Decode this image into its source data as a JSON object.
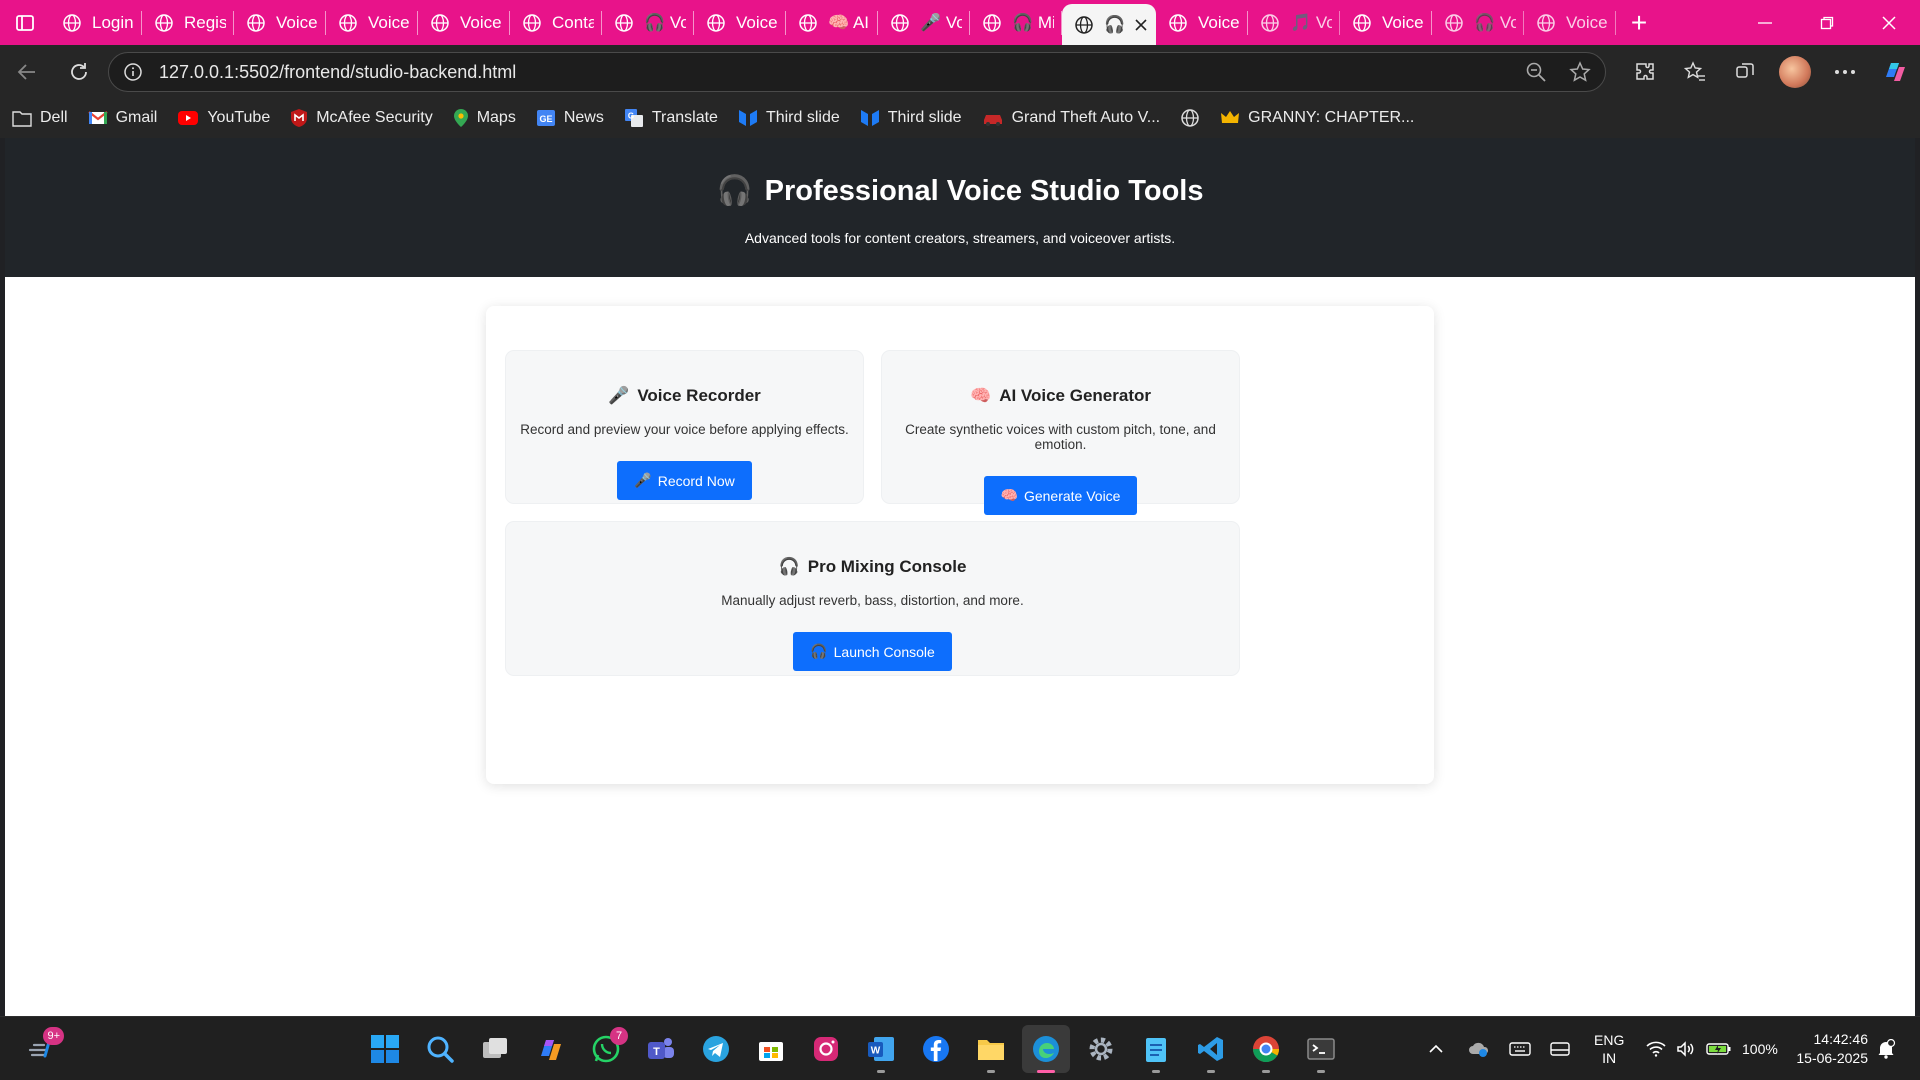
{
  "browser": {
    "tabs": [
      {
        "label": "Login",
        "icon": "globe-icon"
      },
      {
        "label": "Regist",
        "icon": "globe-icon"
      },
      {
        "label": "VoiceC",
        "icon": "globe-icon"
      },
      {
        "label": "VoiceC",
        "icon": "globe-icon"
      },
      {
        "label": "VoiceC",
        "icon": "globe-icon"
      },
      {
        "label": "Conta",
        "icon": "globe-icon"
      },
      {
        "label": "🎧 Vo",
        "icon": "globe-icon"
      },
      {
        "label": "VoiceT",
        "icon": "globe-icon"
      },
      {
        "label": "🧠 AI",
        "icon": "globe-icon"
      },
      {
        "label": "🎤 Vo",
        "icon": "globe-icon"
      },
      {
        "label": "🎧 Mi",
        "icon": "globe-icon"
      },
      {
        "label": "🎧",
        "icon": "globe-icon",
        "active": true
      },
      {
        "label": "VoiceC",
        "icon": "globe-icon"
      },
      {
        "label": "🎵 Vo",
        "icon": "globe-icon"
      },
      {
        "label": "Voice",
        "icon": "globe-icon"
      },
      {
        "label": "🎧 Vo",
        "icon": "globe-icon"
      },
      {
        "label": "VoiceC",
        "icon": "globe-icon"
      }
    ],
    "address": "127.0.0.1:5502/frontend/studio-backend.html",
    "bookmarks": [
      {
        "label": "Dell",
        "icon": "folder-icon"
      },
      {
        "label": "Gmail",
        "icon": "gmail-icon"
      },
      {
        "label": "YouTube",
        "icon": "youtube-icon"
      },
      {
        "label": "McAfee Security",
        "icon": "mcafee-icon"
      },
      {
        "label": "Maps",
        "icon": "maps-icon"
      },
      {
        "label": "News",
        "icon": "news-icon"
      },
      {
        "label": "Translate",
        "icon": "translate-icon"
      },
      {
        "label": "Third slide",
        "icon": "slide-icon"
      },
      {
        "label": "Third slide",
        "icon": "slide-icon"
      },
      {
        "label": "Grand Theft Auto V...",
        "icon": "car-icon"
      },
      {
        "label": "",
        "icon": "globe-icon"
      },
      {
        "label": "GRANNY: CHAPTER...",
        "icon": "crown-icon"
      }
    ]
  },
  "page": {
    "title": "Professional Voice Studio Tools",
    "title_emoji": "🎧",
    "subtitle": "Advanced tools for content creators, streamers, and voiceover artists.",
    "cards": {
      "recorder": {
        "emoji": "🎤",
        "title": "Voice Recorder",
        "desc": "Record and preview your voice before applying effects.",
        "button": "Record Now"
      },
      "generator": {
        "emoji": "🧠",
        "title": "AI Voice Generator",
        "desc": "Create synthetic voices with custom pitch, tone, and emotion.",
        "button": "Generate Voice"
      },
      "mixer": {
        "emoji": "🎧",
        "title": "Pro Mixing Console",
        "desc": "Manually adjust reverb, bass, distortion, and more.",
        "button": "Launch Console"
      }
    }
  },
  "taskbar": {
    "notification_badge": "9+",
    "whatsapp_badge": "7",
    "lang_top": "ENG",
    "lang_bottom": "IN",
    "battery": "100%",
    "time": "14:42:46",
    "date": "15-06-2025"
  },
  "colors": {
    "tab_strip": "#e8138a",
    "accent_button": "#0d6efd",
    "hero_bg": "#212529"
  }
}
